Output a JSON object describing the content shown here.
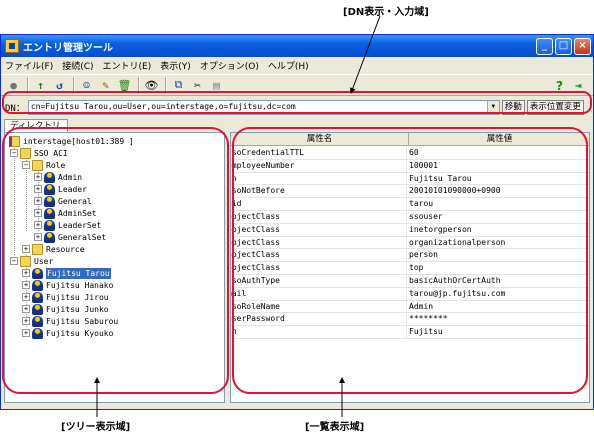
{
  "annotations": {
    "dn_area": "[DN表示・入力域]",
    "tree_area": "[ツリー表示域]",
    "list_area": "[一覧表示域]"
  },
  "window": {
    "title": "エントリ管理ツール",
    "controls": [
      "_",
      "□",
      "×"
    ]
  },
  "menu": [
    "ファイル(F)",
    "接続(C)",
    "エントリ(E)",
    "表示(Y)",
    "オプション(O)",
    "ヘルプ(H)"
  ],
  "toolbar": {
    "icons": [
      "connect-icon",
      "up-icon",
      "refresh-icon",
      "add-user-icon",
      "edit-user-icon",
      "delete-icon",
      "search-icon",
      "copy-icon",
      "cut-icon",
      "paste-icon"
    ],
    "glyphs": [
      "●",
      "↑",
      "↺",
      "☺",
      "✎",
      "🗑",
      "👁",
      "⧉",
      "✂",
      "▤"
    ],
    "help_glyph": "?",
    "exit_glyph": "⇥"
  },
  "dn": {
    "label": "DN：",
    "value": "cn=Fujitsu Tarou,ou=User,ou=interstage,o=fujitsu,dc=com",
    "move_button": "移動",
    "position_button": "表示位置変更"
  },
  "tab": "ディレクトリ",
  "tree": {
    "root": "interstage[host01:389 ]",
    "sso_acl": "SSO ACI",
    "role": "Role",
    "roles": [
      "Admin",
      "Leader",
      "General",
      "AdminSet",
      "LeaderSet",
      "GeneralSet"
    ],
    "resource": "Resource",
    "user": "User",
    "users": [
      "Fujitsu Tarou",
      "Fujitsu Hanako",
      "Fujitsu Jirou",
      "Fujitsu Junko",
      "Fujitsu Saburou",
      "Fujitsu Kyouko"
    ]
  },
  "list": {
    "headers": [
      "属性名",
      "属性値"
    ],
    "rows": [
      [
        "ssoCredentialTTL",
        "60"
      ],
      [
        "employeeNumber",
        "100001"
      ],
      [
        "cn",
        "Fujitsu Tarou"
      ],
      [
        "ssoNotBefore",
        "20010101090000+0900"
      ],
      [
        "uid",
        "tarou"
      ],
      [
        "objectClass",
        "ssouser"
      ],
      [
        "objectClass",
        "inetorgperson"
      ],
      [
        "objectClass",
        "organizationalperson"
      ],
      [
        "objectClass",
        "person"
      ],
      [
        "objectClass",
        "top"
      ],
      [
        "ssoAuthType",
        "basicAuthOrCertAuth"
      ],
      [
        "mail",
        "tarou@jp.fujitsu.com"
      ],
      [
        "ssoRoleName",
        "Admin"
      ],
      [
        "userPassword",
        "********"
      ],
      [
        "sn",
        "Fujitsu"
      ]
    ]
  },
  "colors": {
    "highlight": "#e3122e",
    "selection": "#316ac5",
    "titlebar": "#0654d8"
  }
}
